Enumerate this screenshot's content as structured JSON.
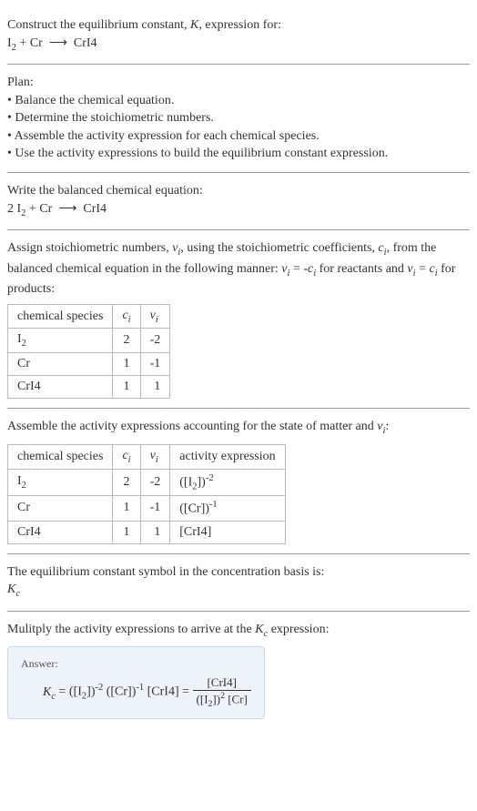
{
  "header": {
    "line1": "Construct the equilibrium constant, K, expression for:",
    "equation": "I₂ + Cr ⟶ CrI4"
  },
  "plan": {
    "title": "Plan:",
    "items": [
      "• Balance the chemical equation.",
      "• Determine the stoichiometric numbers.",
      "• Assemble the activity expression for each chemical species.",
      "• Use the activity expressions to build the equilibrium constant expression."
    ]
  },
  "balanced": {
    "title": "Write the balanced chemical equation:",
    "equation": "2 I₂ + Cr ⟶ CrI4"
  },
  "stoich": {
    "intro": "Assign stoichiometric numbers, νᵢ, using the stoichiometric coefficients, cᵢ, from the balanced chemical equation in the following manner: νᵢ = -cᵢ for reactants and νᵢ = cᵢ for products:",
    "headers": [
      "chemical species",
      "cᵢ",
      "νᵢ"
    ],
    "rows": [
      {
        "species": "I₂",
        "c": "2",
        "v": "-2"
      },
      {
        "species": "Cr",
        "c": "1",
        "v": "-1"
      },
      {
        "species": "CrI4",
        "c": "1",
        "v": "1"
      }
    ]
  },
  "activity": {
    "intro": "Assemble the activity expressions accounting for the state of matter and νᵢ:",
    "headers": [
      "chemical species",
      "cᵢ",
      "νᵢ",
      "activity expression"
    ],
    "rows": [
      {
        "species": "I₂",
        "c": "2",
        "v": "-2",
        "expr": "([I₂])⁻²"
      },
      {
        "species": "Cr",
        "c": "1",
        "v": "-1",
        "expr": "([Cr])⁻¹"
      },
      {
        "species": "CrI4",
        "c": "1",
        "v": "1",
        "expr": "[CrI4]"
      }
    ]
  },
  "symbol": {
    "line1": "The equilibrium constant symbol in the concentration basis is:",
    "line2": "K_c"
  },
  "multiply": {
    "text": "Mulitply the activity expressions to arrive at the K_c expression:"
  },
  "answer": {
    "label": "Answer:",
    "lhs": "K_c = ([I₂])⁻² ([Cr])⁻¹ [CrI4] = ",
    "num": "[CrI4]",
    "den": "([I₂])² [Cr]"
  }
}
